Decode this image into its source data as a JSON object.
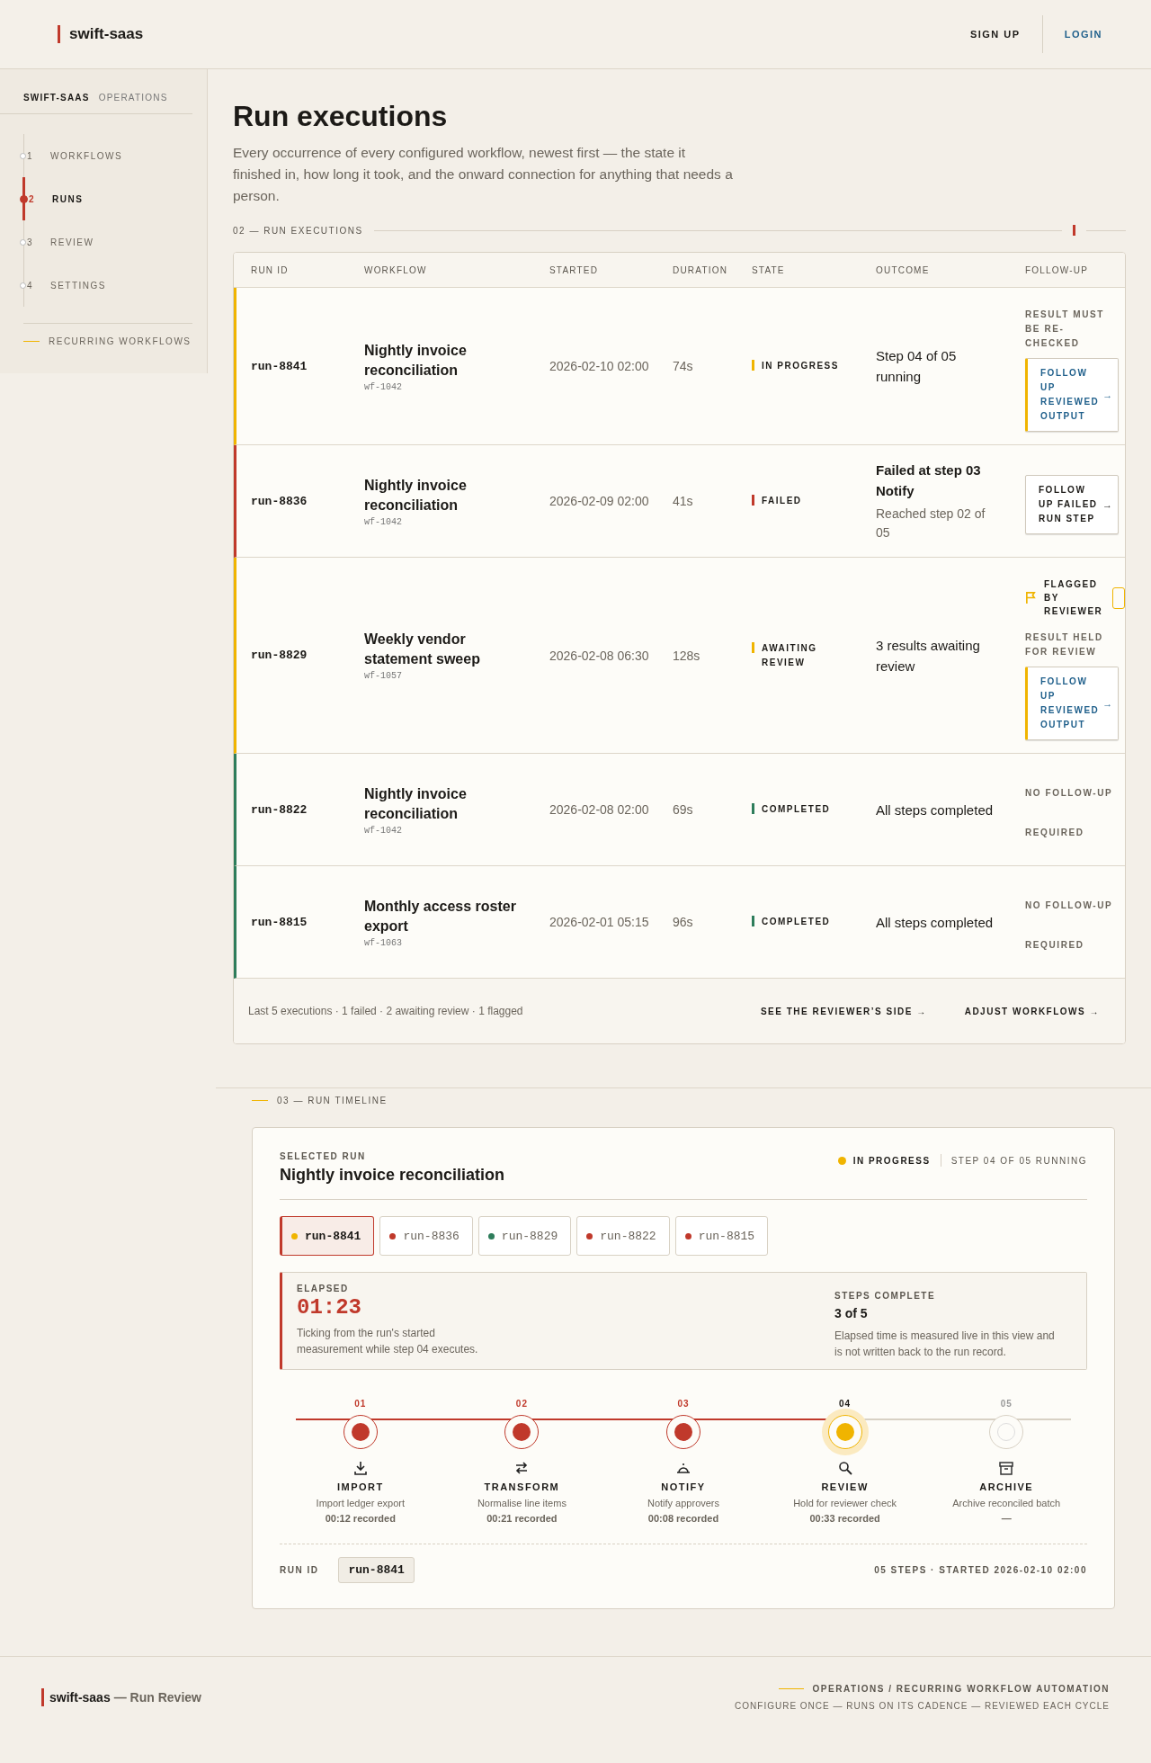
{
  "header": {
    "brand": "swift-saas",
    "links": [
      {
        "label": "SIGN UP",
        "kind": "plain"
      },
      {
        "label": "LOGIN",
        "kind": "accent"
      }
    ]
  },
  "sidebar": {
    "brand": "SWIFT-SAAS",
    "section": "OPERATIONS",
    "items": [
      {
        "number": "1",
        "label": "WORKFLOWS",
        "selected": false
      },
      {
        "number": "2",
        "label": "RUNS",
        "selected": true
      },
      {
        "number": "3",
        "label": "REVIEW",
        "selected": false
      },
      {
        "number": "4",
        "label": "SETTINGS",
        "selected": false
      }
    ],
    "footer_link": "RECURRING WORKFLOWS"
  },
  "page": {
    "title": "Run executions",
    "description": "Every occurrence of every configured workflow, newest first — the state it finished in, how long it took, and the onward connection for anything that needs a person.",
    "section_label": "02 — RUN EXECUTIONS"
  },
  "table": {
    "columns": [
      "RUN ID",
      "WORKFLOW",
      "STARTED",
      "DURATION",
      "STATE",
      "OUTCOME",
      "FOLLOW-UP"
    ],
    "rows": [
      {
        "run_id": "run-8841",
        "workflow": "Nightly invoice reconciliation",
        "workflow_id": "wf-1042",
        "started": "2026-02-10 02:00",
        "duration": "74s",
        "state": {
          "label": "IN PROGRESS",
          "kind": "in_progress"
        },
        "outcome": {
          "text": "Step 04 of 05 running"
        },
        "follow_up": {
          "note": "RESULT MUST BE RE-CHECKED",
          "button": {
            "label": "FOLLOW UP REVIEWED OUTPUT",
            "arrow": "→",
            "kind": "review"
          }
        }
      },
      {
        "run_id": "run-8836",
        "workflow": "Nightly invoice reconciliation",
        "workflow_id": "wf-1042",
        "started": "2026-02-09 02:00",
        "duration": "41s",
        "state": {
          "label": "FAILED",
          "kind": "failed"
        },
        "outcome": {
          "title": "Failed at step 03 Notify",
          "text": "Reached step 02 of 05"
        },
        "follow_up": {
          "button": {
            "label": "FOLLOW UP FAILED RUN STEP",
            "arrow": "→",
            "kind": "failed"
          }
        }
      },
      {
        "run_id": "run-8829",
        "workflow": "Weekly vendor statement sweep",
        "workflow_id": "wf-1057",
        "started": "2026-02-08 06:30",
        "duration": "128s",
        "state": {
          "label": "AWAITING REVIEW",
          "kind": "awaiting_review"
        },
        "outcome": {
          "text": "3 results awaiting review"
        },
        "follow_up": {
          "flag": "FLAGGED BY REVIEWER",
          "note": "RESULT HELD FOR REVIEW",
          "button": {
            "label": "FOLLOW UP REVIEWED OUTPUT",
            "arrow": "→",
            "kind": "review"
          }
        }
      },
      {
        "run_id": "run-8822",
        "workflow": "Nightly invoice reconciliation",
        "workflow_id": "wf-1042",
        "started": "2026-02-08 02:00",
        "duration": "69s",
        "state": {
          "label": "COMPLETED",
          "kind": "completed"
        },
        "outcome": {
          "text": "All steps completed"
        },
        "follow_up": {
          "none": "NO FOLLOW-UP REQUIRED"
        }
      },
      {
        "run_id": "run-8815",
        "workflow": "Monthly access roster export",
        "workflow_id": "wf-1063",
        "started": "2026-02-01 05:15",
        "duration": "96s",
        "state": {
          "label": "COMPLETED",
          "kind": "completed"
        },
        "outcome": {
          "text": "All steps completed"
        },
        "follow_up": {
          "none": "NO FOLLOW-UP REQUIRED"
        }
      }
    ],
    "summary": "Last 5 executions · 1 failed · 2 awaiting review · 1 flagged",
    "links": [
      "SEE THE REVIEWER’S SIDE →",
      "ADJUST WORKFLOWS →"
    ]
  },
  "timeline": {
    "section_label": "03 — RUN TIMELINE",
    "eyebrow": "SELECTED RUN",
    "title": "Nightly invoice reconciliation",
    "status": {
      "label": "IN PROGRESS",
      "kind": "in_progress",
      "detail": "STEP 04 OF 05 RUNNING"
    },
    "chips": [
      {
        "label": "run-8841",
        "color": "#f0b400",
        "selected": true
      },
      {
        "label": "run-8836",
        "color": "#c0392b",
        "selected": false
      },
      {
        "label": "run-8829",
        "color": "#2e7d5b",
        "selected": false
      },
      {
        "label": "run-8822",
        "color": "#c0392b",
        "selected": false
      },
      {
        "label": "run-8815",
        "color": "#c0392b",
        "selected": false
      }
    ],
    "elapsed": {
      "label": "ELAPSED",
      "value": "01:23",
      "note": "Ticking from the run's started measurement while step 04 executes."
    },
    "steps_complete": {
      "label": "STEPS COMPLETE",
      "value": "3 of 5",
      "note": "Elapsed time is measured live in this view and is not written back to the run record."
    },
    "steps": [
      {
        "number": "01",
        "name": "IMPORT",
        "desc": "Import ledger export",
        "recorded": "00:12 recorded",
        "kind": "done"
      },
      {
        "number": "02",
        "name": "TRANSFORM",
        "desc": "Normalise line items",
        "recorded": "00:21 recorded",
        "kind": "done"
      },
      {
        "number": "03",
        "name": "NOTIFY",
        "desc": "Notify approvers",
        "recorded": "00:08 recorded",
        "kind": "done"
      },
      {
        "number": "04",
        "name": "REVIEW",
        "desc": "Hold for reviewer check",
        "recorded": "00:33 recorded",
        "kind": "current"
      },
      {
        "number": "05",
        "name": "ARCHIVE",
        "desc": "Archive reconciled batch",
        "recorded": "—",
        "kind": "pending"
      }
    ],
    "run_id_label": "RUN ID",
    "run_id": "run-8841",
    "meta": "05 STEPS · STARTED 2026-02-10 02:00"
  },
  "footer": {
    "brand": "swift-saas",
    "subtitle": "— Run Review",
    "tagline": "OPERATIONS / RECURRING WORKFLOW AUTOMATION",
    "motto": "CONFIGURE ONCE — RUNS ON ITS CADENCE — REVIEWED EACH CYCLE"
  }
}
